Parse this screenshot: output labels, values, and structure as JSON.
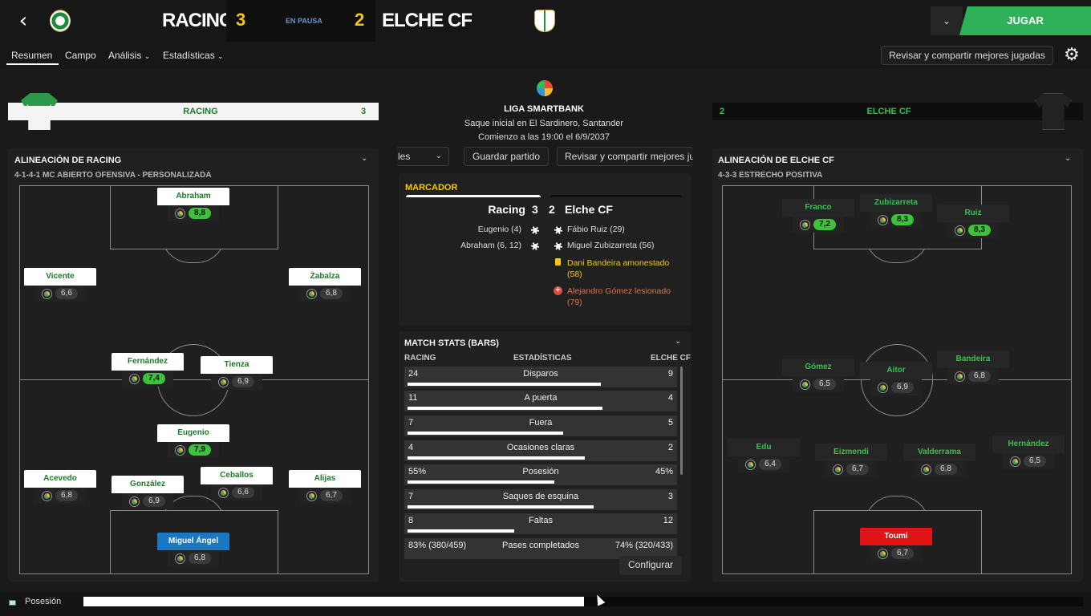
{
  "header": {
    "home_team": "RACING",
    "home_score": "3",
    "status": "EN PAUSA",
    "away_score": "2",
    "away_team": "ELCHE CF",
    "play_button": "JUGAR"
  },
  "tabs": {
    "resumen": "Resumen",
    "campo": "Campo",
    "analisis": "Análisis",
    "estadisticas": "Estadísticas",
    "review_button": "Revisar y compartir mejores jugadas"
  },
  "home_banner": {
    "name": "RACING",
    "score": "3"
  },
  "away_banner": {
    "score": "2",
    "name": "ELCHE CF"
  },
  "match_info": {
    "league": "LIGA SMARTBANK",
    "venue": "Saque inicial en El Sardinero, Santander",
    "kickoff": "Comienzo a las 19:00 el 6/9/2037"
  },
  "mid_buttons": {
    "les": "les",
    "save": "Guardar partido",
    "review": "Revisar y compartir mejores ju"
  },
  "scoreboard": {
    "title": "MARCADOR",
    "home": "Racing",
    "home_score": "3",
    "away_score": "2",
    "away": "Elche CF",
    "home_events": [
      "Eugenio (4)",
      "Abraham (6, 12)"
    ],
    "away_goals": [
      "Fábio Ruiz (29)",
      "Miguel Zubizarreta (56)"
    ],
    "yellow": {
      "line1": "Dani Bandeira amonestado",
      "line2": "(58)"
    },
    "injury": {
      "line1": "Alejandro Gómez lesionado",
      "line2": "(79)"
    }
  },
  "stats": {
    "title": "MATCH STATS (BARS)",
    "col_home": "RACING",
    "col_mid": "ESTADÍSTICAS",
    "col_away": "ELCHE CF",
    "rows": [
      {
        "home": "24",
        "label": "Disparos",
        "away": "9",
        "fraction": 0.727
      },
      {
        "home": "11",
        "label": "A puerta",
        "away": "4",
        "fraction": 0.733
      },
      {
        "home": "7",
        "label": "Fuera",
        "away": "5",
        "fraction": 0.583
      },
      {
        "home": "4",
        "label": "Ocasiones claras",
        "away": "2",
        "fraction": 0.667
      },
      {
        "home": "55%",
        "label": "Posesión",
        "away": "45%",
        "fraction": 0.55
      },
      {
        "home": "7",
        "label": "Saques de esquina",
        "away": "3",
        "fraction": 0.7
      },
      {
        "home": "8",
        "label": "Faltas",
        "away": "12",
        "fraction": 0.4
      },
      {
        "home": "83% (380/459)",
        "label": "Pases completados",
        "away": "74% (320/433)"
      }
    ],
    "configure": "Configurar"
  },
  "home_lineup": {
    "title": "ALINEACIÓN DE RACING",
    "formation": "4-1-4-1 MC ABIERTO OFENSIVA - PERSONALIZADA",
    "players": [
      {
        "name": "Abraham",
        "rating": "8,8",
        "high": true
      },
      {
        "name": "Vicente",
        "rating": "6,6"
      },
      {
        "name": "Zabalza",
        "rating": "6,8"
      },
      {
        "name": "Fernández",
        "rating": "7,4",
        "high": true
      },
      {
        "name": "Tienza",
        "rating": "6,9"
      },
      {
        "name": "Eugenio",
        "rating": "7,9",
        "high": true
      },
      {
        "name": "Acevedo",
        "rating": "6,8"
      },
      {
        "name": "González",
        "rating": "6,9"
      },
      {
        "name": "Ceballos",
        "rating": "6,6"
      },
      {
        "name": "Alijas",
        "rating": "6,7"
      },
      {
        "name": "Miguel Ángel",
        "rating": "6,8"
      }
    ]
  },
  "away_lineup": {
    "title": "ALINEACIÓN DE ELCHE CF",
    "formation": "4-3-3 ESTRECHO POSITIVA",
    "players": [
      {
        "name": "Franco",
        "rating": "7,2",
        "high": true
      },
      {
        "name": "Zubizarreta",
        "rating": "8,3",
        "high": true
      },
      {
        "name": "Ruiz",
        "rating": "8,3",
        "high": true
      },
      {
        "name": "Gómez",
        "rating": "6,5"
      },
      {
        "name": "Aitor",
        "rating": "6,9"
      },
      {
        "name": "Bandeira",
        "rating": "6,8"
      },
      {
        "name": "Edu",
        "rating": "6,4"
      },
      {
        "name": "Eizmendi",
        "rating": "6,7"
      },
      {
        "name": "Valderrama",
        "rating": "6,8"
      },
      {
        "name": "Hernández",
        "rating": "6,5"
      },
      {
        "name": "Toumi",
        "rating": "6,7"
      }
    ]
  },
  "bottom": {
    "label": "Posesión",
    "home_possession": 0.55
  },
  "colors": {
    "accent_green": "#2fb15a",
    "score_yellow": "#f5c518",
    "keeper_blue": "#1a78c2",
    "keeper_red": "#e01414"
  }
}
